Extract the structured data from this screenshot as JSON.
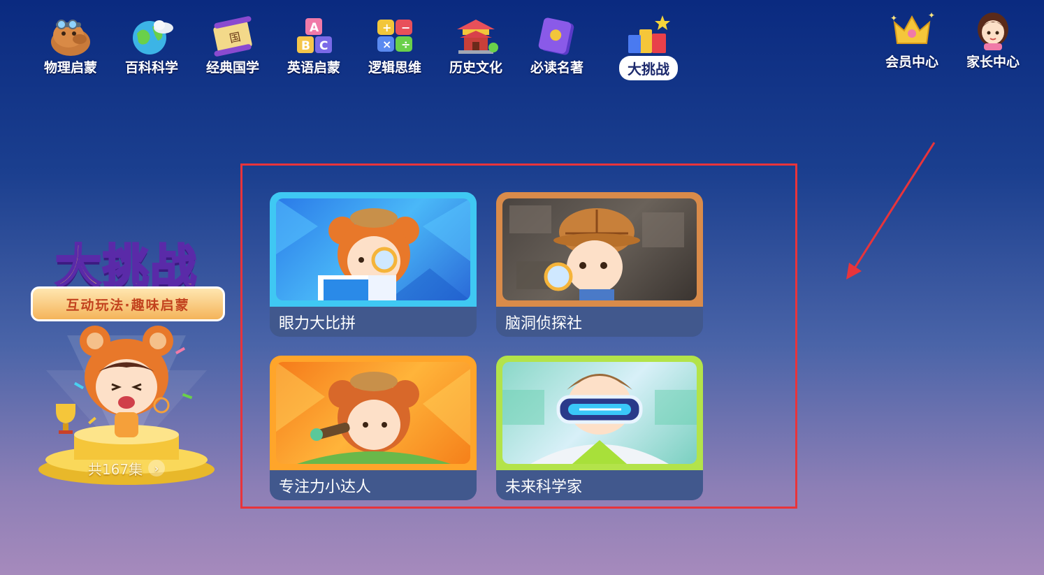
{
  "nav": {
    "items": [
      {
        "label": "物理启蒙",
        "icon": "capybara-icon"
      },
      {
        "label": "百科科学",
        "icon": "globe-icon"
      },
      {
        "label": "经典国学",
        "icon": "scroll-icon"
      },
      {
        "label": "英语启蒙",
        "icon": "abc-blocks-icon"
      },
      {
        "label": "逻辑思维",
        "icon": "puzzle-icon"
      },
      {
        "label": "历史文化",
        "icon": "temple-icon"
      },
      {
        "label": "必读名著",
        "icon": "book-icon"
      },
      {
        "label": "大挑战",
        "icon": "blocks-star-icon",
        "active": true
      }
    ],
    "right": [
      {
        "label": "会员中心",
        "icon": "crown-icon"
      },
      {
        "label": "家长中心",
        "icon": "parent-avatar-icon"
      }
    ]
  },
  "promo": {
    "title": "大挑战",
    "subtitle": "互动玩法·趣味启蒙",
    "count": "共167集"
  },
  "cards": [
    {
      "label": "眼力大比拼",
      "frame_color": "#3fc8f3",
      "art": "detective-bear-magnifier"
    },
    {
      "label": "脑洞侦探社",
      "frame_color": "#d98b4a",
      "art": "detective-boy-magnifier"
    },
    {
      "label": "专注力小达人",
      "frame_color": "#ffa52a",
      "art": "detective-bear-telescope"
    },
    {
      "label": "未来科学家",
      "frame_color": "#b3e34a",
      "art": "scientist-vr-goggles"
    }
  ],
  "annotation": {
    "highlight_color": "#e8343b"
  }
}
